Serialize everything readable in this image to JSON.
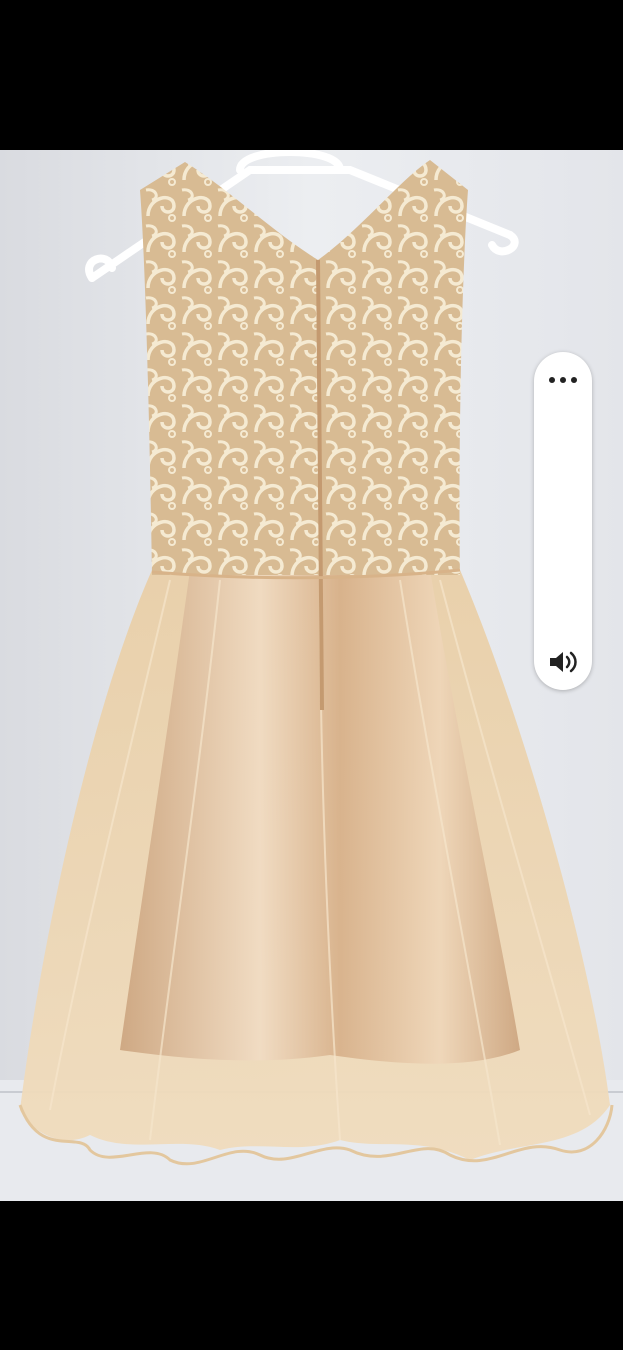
{
  "screen": {
    "background": "#000000"
  },
  "photo": {
    "icon": "photo-of-dress-on-hanger",
    "colors": {
      "wall": "#e6e8ec",
      "lace": "#f2e3c4",
      "lining": "#e2c49c",
      "tulle": "#ecd2aa",
      "satin": "#d8b189",
      "hanger": "#ffffff"
    }
  },
  "volume_panel": {
    "more_icon": "more-horizontal-icon",
    "volume_icon": "speaker-volume-icon",
    "level": 0,
    "colors": {
      "panel": "#ffffff",
      "icon": "#222222"
    }
  }
}
